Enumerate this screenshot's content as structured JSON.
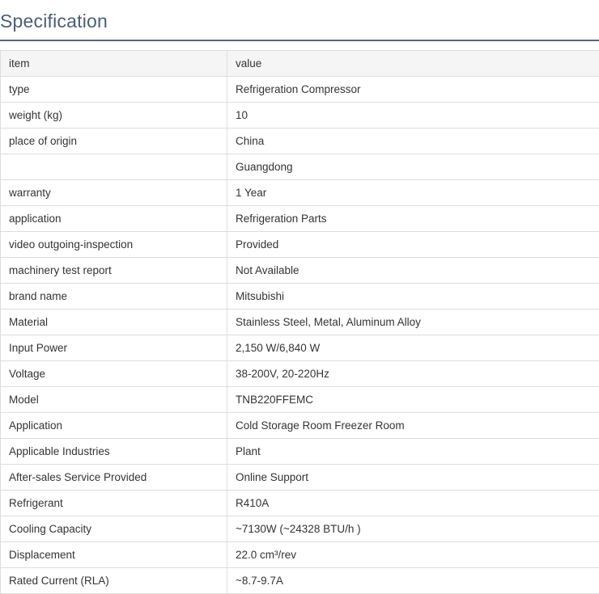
{
  "title": "Specification",
  "table": {
    "headers": [
      "item",
      "value"
    ],
    "rows": [
      [
        "type",
        "Refrigeration Compressor"
      ],
      [
        "weight (kg)",
        "10"
      ],
      [
        "place of origin",
        "China"
      ],
      [
        "",
        "Guangdong"
      ],
      [
        "warranty",
        "1 Year"
      ],
      [
        "application",
        "Refrigeration Parts"
      ],
      [
        "video outgoing-inspection",
        "Provided"
      ],
      [
        "machinery test report",
        "Not Available"
      ],
      [
        "brand name",
        "Mitsubishi"
      ],
      [
        "Material",
        "Stainless Steel, Metal, Aluminum Alloy"
      ],
      [
        "Input Power",
        "2,150 W/6,840 W"
      ],
      [
        "Voltage",
        "38-200V, 20-220Hz"
      ],
      [
        "Model",
        "TNB220FFEMC"
      ],
      [
        "Application",
        "Cold Storage Room Freezer Room"
      ],
      [
        "Applicable Industries",
        "Plant"
      ],
      [
        "After-sales Service Provided",
        "Online Support"
      ],
      [
        "Refrigerant",
        "R410A"
      ],
      [
        "Cooling Capacity",
        "~7130W (~24328 BTU/h )"
      ],
      [
        "Displacement",
        "22.0 cm³/rev"
      ],
      [
        "Rated Current (RLA)",
        "~8.7-9.7A"
      ]
    ]
  }
}
